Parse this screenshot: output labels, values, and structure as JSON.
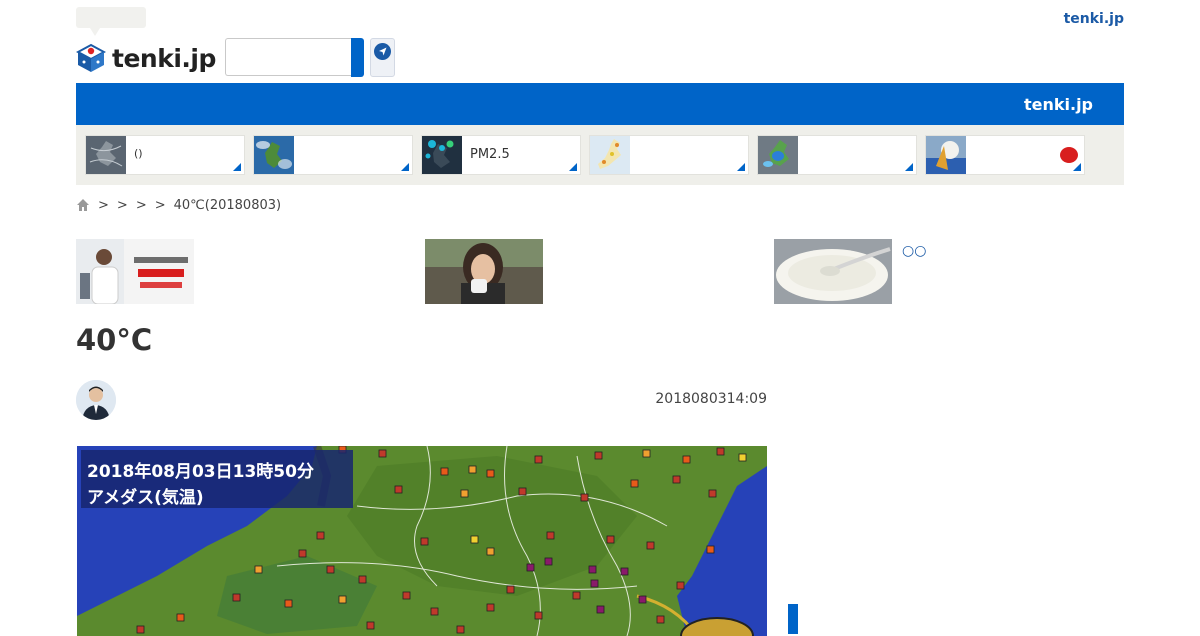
{
  "header": {
    "logo_text": "tenki.jp",
    "top_right_link": "tenki.jp",
    "search": {
      "value": "",
      "placeholder": ""
    }
  },
  "bluebar": {
    "title": "tenki.jp"
  },
  "tiles": [
    {
      "label": "()"
    },
    {
      "label": ""
    },
    {
      "label": "PM2.5"
    },
    {
      "label": ""
    },
    {
      "label": ""
    },
    {
      "label": ""
    }
  ],
  "breadcrumb": {
    "items": [
      ">",
      ">",
      ">",
      ">"
    ],
    "current": "40℃(20180803)"
  },
  "ads": {
    "text": "○○"
  },
  "article": {
    "title": "40°C",
    "date": "2018080314:09"
  },
  "map": {
    "caption_line1": "2018年08月03日13時50分",
    "caption_line2": "アメダス(気温)"
  },
  "colors": {
    "accent": "#0064c8",
    "tile_bg": "#efefea",
    "link": "#1b5aa6"
  }
}
